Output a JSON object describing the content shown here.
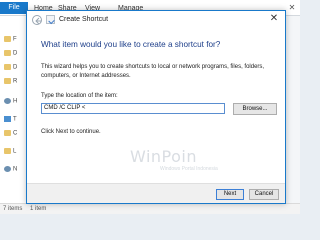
{
  "explorer": {
    "tabs": [
      "File",
      "Home",
      "Share",
      "View",
      "Manage"
    ],
    "nav_items": [
      "F",
      "D",
      "D",
      "R",
      "H",
      "T",
      "C",
      "L",
      "N"
    ],
    "status_text": "7 items",
    "status_right": "1 item"
  },
  "dialog": {
    "title": "Create Shortcut",
    "heading": "What item would you like to create a shortcut for?",
    "description": "This wizard helps you to create shortcuts to local or network programs, files, folders, computers, or Internet addresses.",
    "location_label": "Type the location of the item:",
    "location_value": "CMD /C CLIP <",
    "browse_label": "Browse...",
    "hint": "Click Next to continue.",
    "next_label": "Next",
    "cancel_label": "Cancel",
    "close_glyph": "✕"
  },
  "watermark": {
    "brand": "WinPoin",
    "tagline": "Windows Portal Indonesia"
  },
  "colors": {
    "accent": "#1979ca",
    "heading": "#1e3f8a",
    "input_border": "#5a8ed0"
  }
}
